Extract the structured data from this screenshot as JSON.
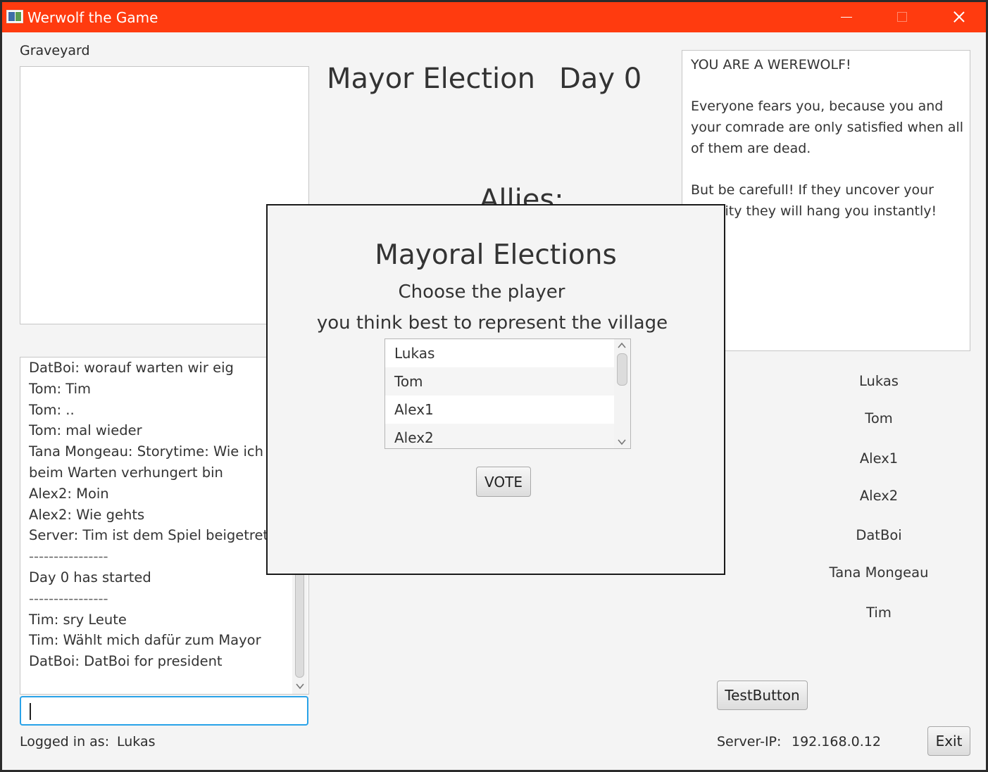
{
  "window": {
    "title": "Werwolf the Game"
  },
  "graveyard": {
    "label": "Graveyard"
  },
  "header": {
    "phase": "Mayor Election",
    "day": "Day 0",
    "allies_label": "Allies:"
  },
  "role_info": {
    "lines": [
      "YOU ARE A WEREWOLF!",
      "Everyone fears you, because you and your comrade are only satisfied when all of them are dead.",
      "But be carefull! If they uncover your identity they will hang you instantly!"
    ]
  },
  "chat": {
    "messages": [
      "DatBoi: worauf warten wir eig",
      "Tom: Tim",
      "Tom: ..",
      "Tom: mal wieder",
      "Tana Mongeau: Storytime: Wie ich beim Warten verhungert bin",
      "Alex2: Moin",
      "Alex2: Wie gehts",
      "Server: Tim ist dem Spiel beigetreten",
      "----------------",
      "Day 0 has started",
      "----------------",
      "Tim: sry Leute",
      "Tim: Wählt mich dafür zum Mayor",
      "DatBoi: DatBoi for president"
    ],
    "input_value": ""
  },
  "players": [
    "Lukas",
    "Tom",
    "Alex1",
    "Alex2",
    "DatBoi",
    "Tana Mongeau",
    "Tim"
  ],
  "footer": {
    "logged_in_label": "Logged in as:",
    "logged_in_user": "Lukas",
    "server_ip_label": "Server-IP:",
    "server_ip": "192.168.0.12",
    "test_button": "TestButton",
    "exit_button": "Exit"
  },
  "dialog": {
    "title": "Mayoral Elections",
    "subtitle_1": "Choose the player",
    "subtitle_2": "you think best to represent the village",
    "candidates": [
      "Lukas",
      "Tom",
      "Alex1",
      "Alex2"
    ],
    "vote_button": "VOTE"
  },
  "colors": {
    "titlebar": "#ff3b0f",
    "focus_border": "#29a2e8",
    "background": "#f4f4f4"
  }
}
